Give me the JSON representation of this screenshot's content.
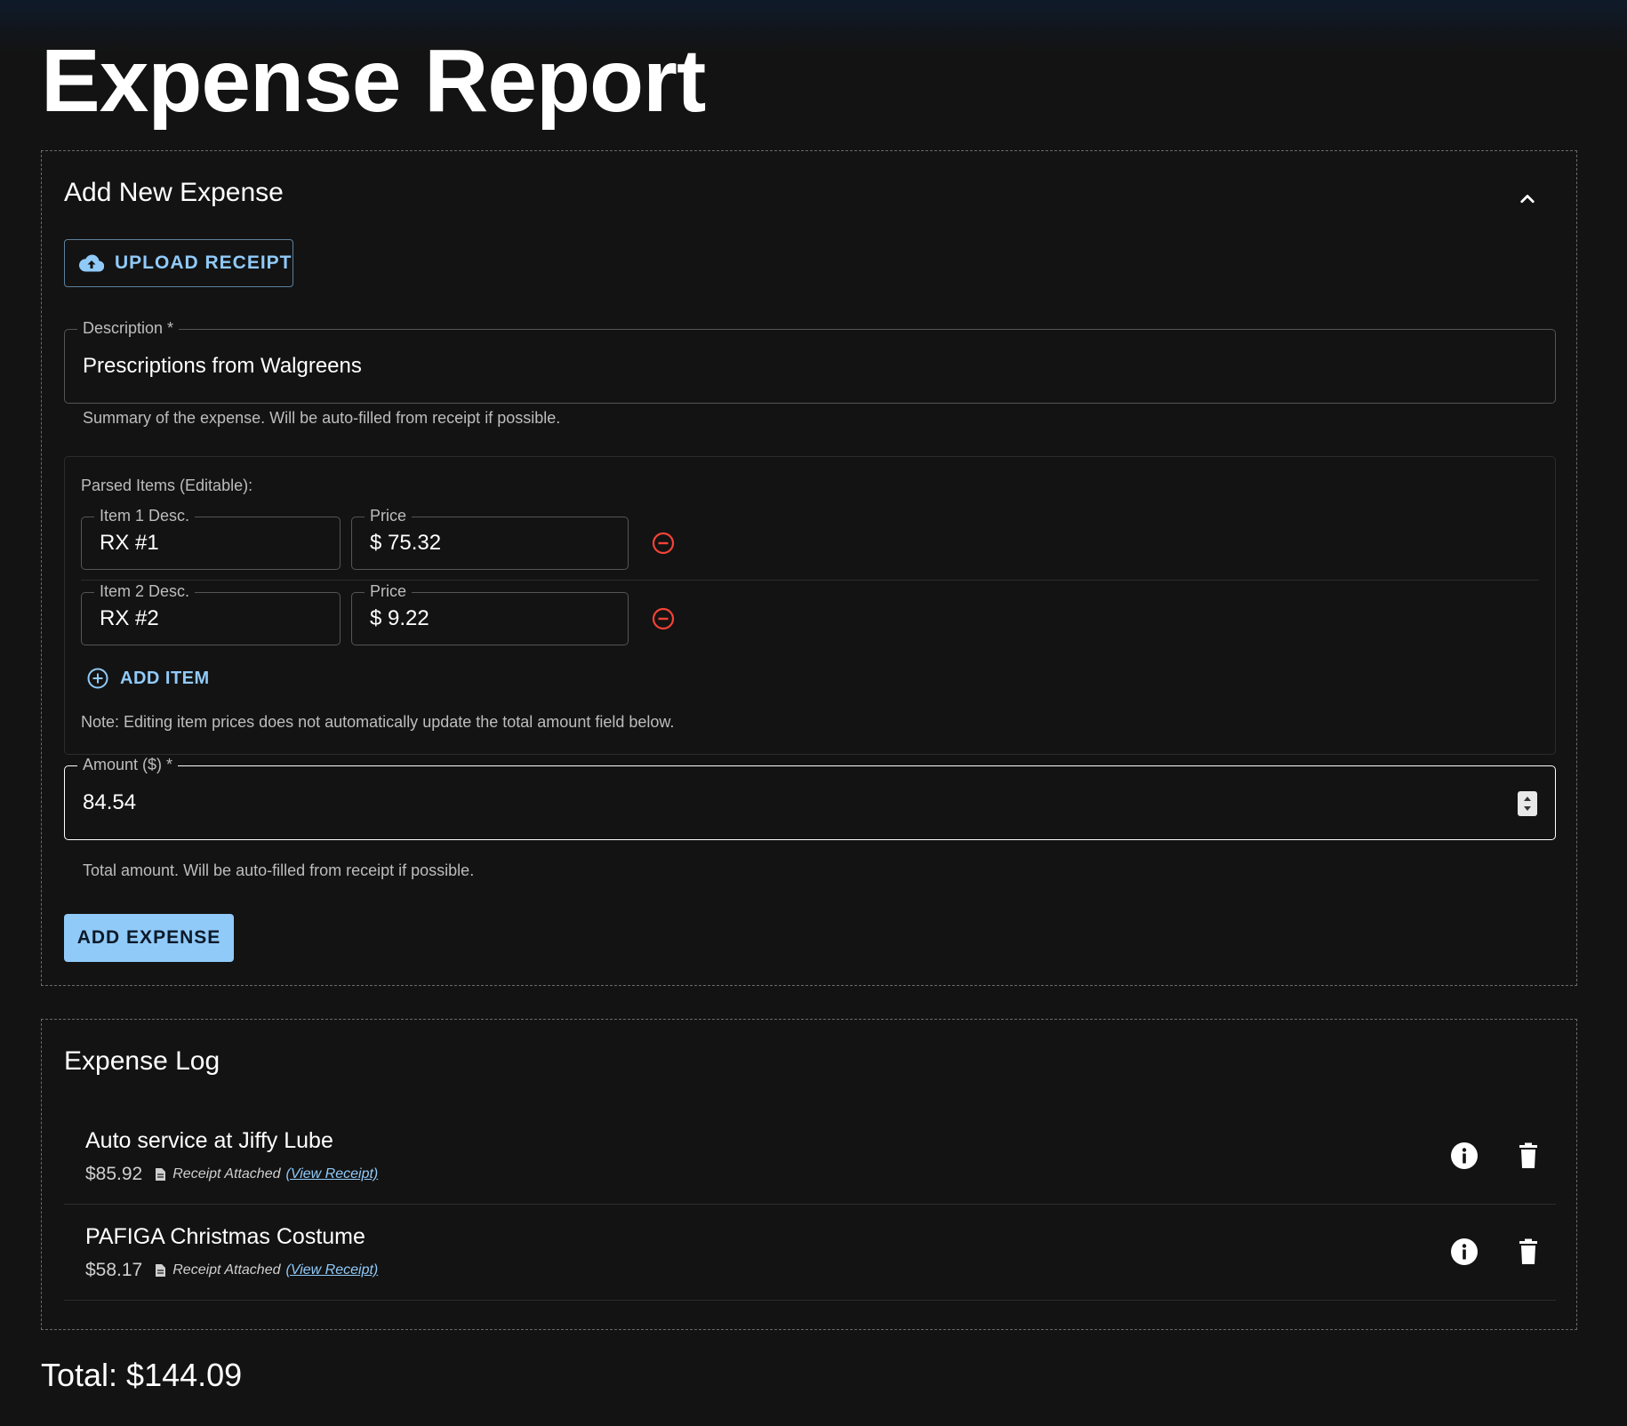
{
  "page": {
    "title": "Expense Report",
    "total": "Total: $144.09"
  },
  "add_expense": {
    "header": "Add New Expense",
    "upload_label": "UPLOAD RECEIPT",
    "description": {
      "label": "Description *",
      "value": "Prescriptions from Walgreens",
      "helper": "Summary of the expense. Will be auto-filled from receipt if possible."
    },
    "parsed_items": {
      "label": "Parsed Items (Editable):",
      "items": [
        {
          "desc_label": "Item 1 Desc.",
          "desc_value": "RX #1",
          "price_label": "Price",
          "price_value": "$ 75.32"
        },
        {
          "desc_label": "Item 2 Desc.",
          "desc_value": "RX #2",
          "price_label": "Price",
          "price_value": "$ 9.22"
        }
      ],
      "add_item_label": "ADD ITEM",
      "note": "Note: Editing item prices does not automatically update the total amount field below."
    },
    "amount": {
      "label": "Amount ($) *",
      "value": "84.54",
      "helper": "Total amount. Will be auto-filled from receipt if possible."
    },
    "submit_label": "ADD EXPENSE"
  },
  "expense_log": {
    "header": "Expense Log",
    "entries": [
      {
        "title": "Auto service at Jiffy Lube",
        "amount": "$85.92",
        "receipt_text": "Receipt Attached",
        "view_text": "(View Receipt)"
      },
      {
        "title": "PAFIGA Christmas Costume",
        "amount": "$58.17",
        "receipt_text": "Receipt Attached",
        "view_text": "(View Receipt)"
      }
    ]
  },
  "colors": {
    "accent": "#90caf9",
    "danger": "#f44336",
    "background": "#131313"
  },
  "icons": [
    "cloud-upload-icon",
    "chevron-up-icon",
    "remove-circle-icon",
    "add-circle-icon",
    "document-icon",
    "info-icon",
    "trash-icon",
    "spinner-icon"
  ]
}
